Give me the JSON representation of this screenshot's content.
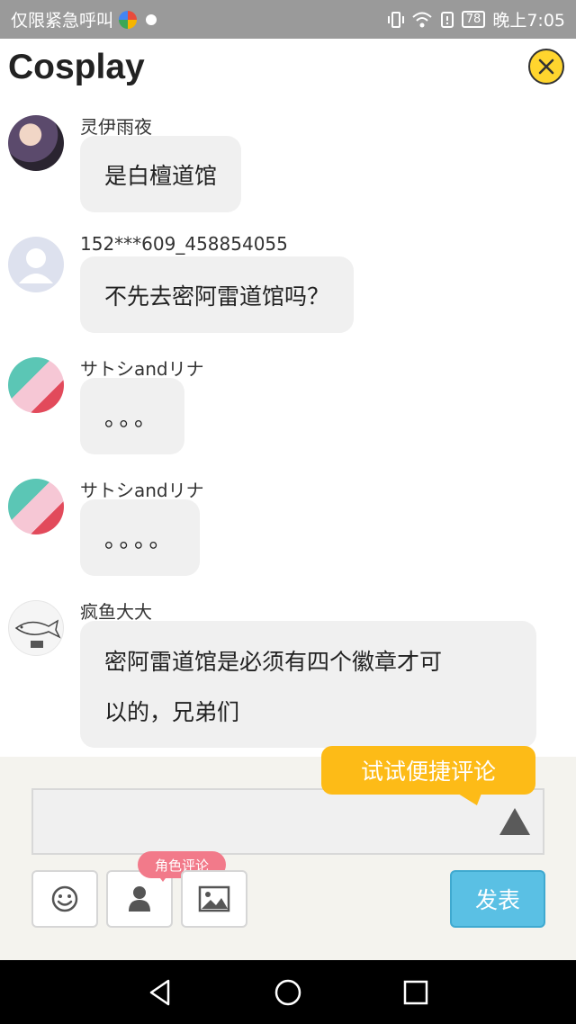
{
  "status_bar": {
    "carrier": "仅限紧急呼叫",
    "battery": "78",
    "time": "晚上7:05"
  },
  "header": {
    "title": "Cosplay",
    "close_icon": "close-circle-icon"
  },
  "messages": [
    {
      "user": "灵伊雨夜",
      "text": "是白檀道馆"
    },
    {
      "user": "152***609_458854055",
      "text": "不先去密阿雷道馆吗？"
    },
    {
      "user": "サトシandリナ",
      "text": "。。。"
    },
    {
      "user": "サトシandリナ",
      "text": "。。。。"
    },
    {
      "user": "疯鱼大大",
      "line1": "密阿雷道馆是必须有四个徽章才可",
      "line2": "以的，兄弟们"
    }
  ],
  "input": {
    "quick_comment_tip": "试试便捷评论",
    "role_comment_badge": "角色评论",
    "post_label": "发表"
  },
  "colors": {
    "accent_yellow": "#fdbb17",
    "post_blue": "#5ac0e4",
    "badge_pink": "#f27a8a",
    "bubble_gray": "#f0f0f0"
  }
}
